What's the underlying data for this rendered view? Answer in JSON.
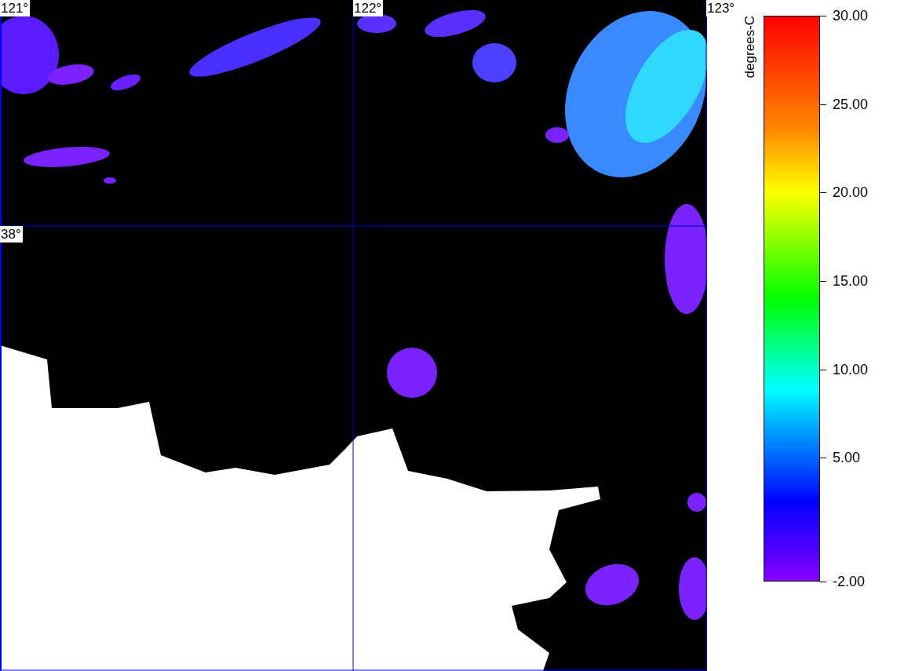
{
  "map": {
    "longitude_labels": [
      "121°",
      "122°",
      "123°"
    ],
    "latitude_labels": [
      "38°"
    ]
  },
  "legend": {
    "title": "degrees-C",
    "ticks": [
      {
        "label": "30.00"
      },
      {
        "label": "25.00"
      },
      {
        "label": "20.00"
      },
      {
        "label": "15.00"
      },
      {
        "label": "10.00"
      },
      {
        "label": "5.00"
      },
      {
        "label": "-2.00"
      }
    ]
  }
}
